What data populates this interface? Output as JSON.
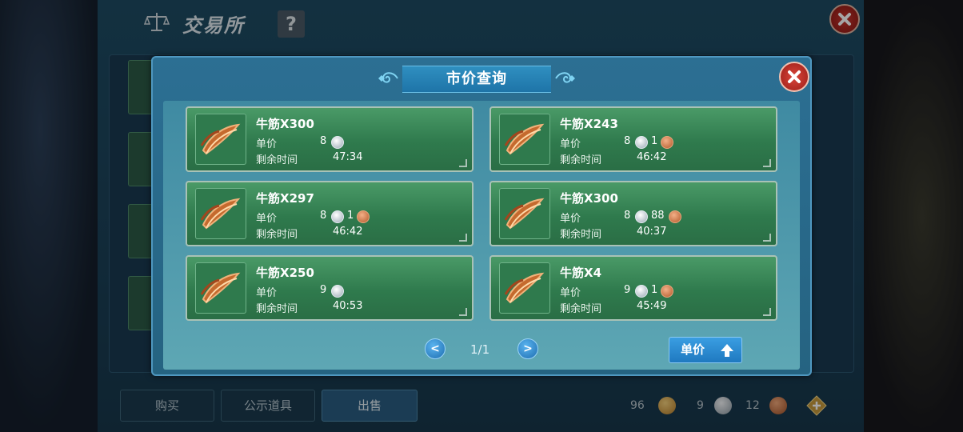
{
  "exchange": {
    "title": "交易所",
    "help_label": "?",
    "tabs": [
      {
        "label": "购买"
      },
      {
        "label": "公示道具"
      },
      {
        "label": "出售",
        "active": true
      }
    ],
    "currencies": [
      {
        "value": "96",
        "icon": "gold-coin-icon"
      },
      {
        "value": "9",
        "icon": "silver-coin-icon"
      },
      {
        "value": "12",
        "icon": "copper-coin-icon"
      }
    ]
  },
  "modal": {
    "title": "市价查询",
    "price_label": "单价",
    "time_label": "剩余时间",
    "listings": [
      {
        "name": "牛筋X300",
        "silver": "8",
        "copper": null,
        "time": "47:34"
      },
      {
        "name": "牛筋X243",
        "silver": "8",
        "copper": "1",
        "time": "46:42"
      },
      {
        "name": "牛筋X297",
        "silver": "8",
        "copper": "1",
        "time": "46:42"
      },
      {
        "name": "牛筋X300",
        "silver": "8",
        "copper": "88",
        "time": "40:37"
      },
      {
        "name": "牛筋X250",
        "silver": "9",
        "copper": null,
        "time": "40:53"
      },
      {
        "name": "牛筋X4",
        "silver": "9",
        "copper": "1",
        "time": "45:49"
      }
    ],
    "pagination": {
      "prev": "<",
      "next": ">",
      "indicator": "1/1"
    },
    "sort_button": {
      "label": "单价",
      "icon": "sort-arrow-up-icon"
    }
  },
  "colors": {
    "card_green": "#2f7a4d",
    "modal_blue": "#2c6f93",
    "accent_blue": "#1f79c0",
    "close_red": "#c8352e"
  }
}
